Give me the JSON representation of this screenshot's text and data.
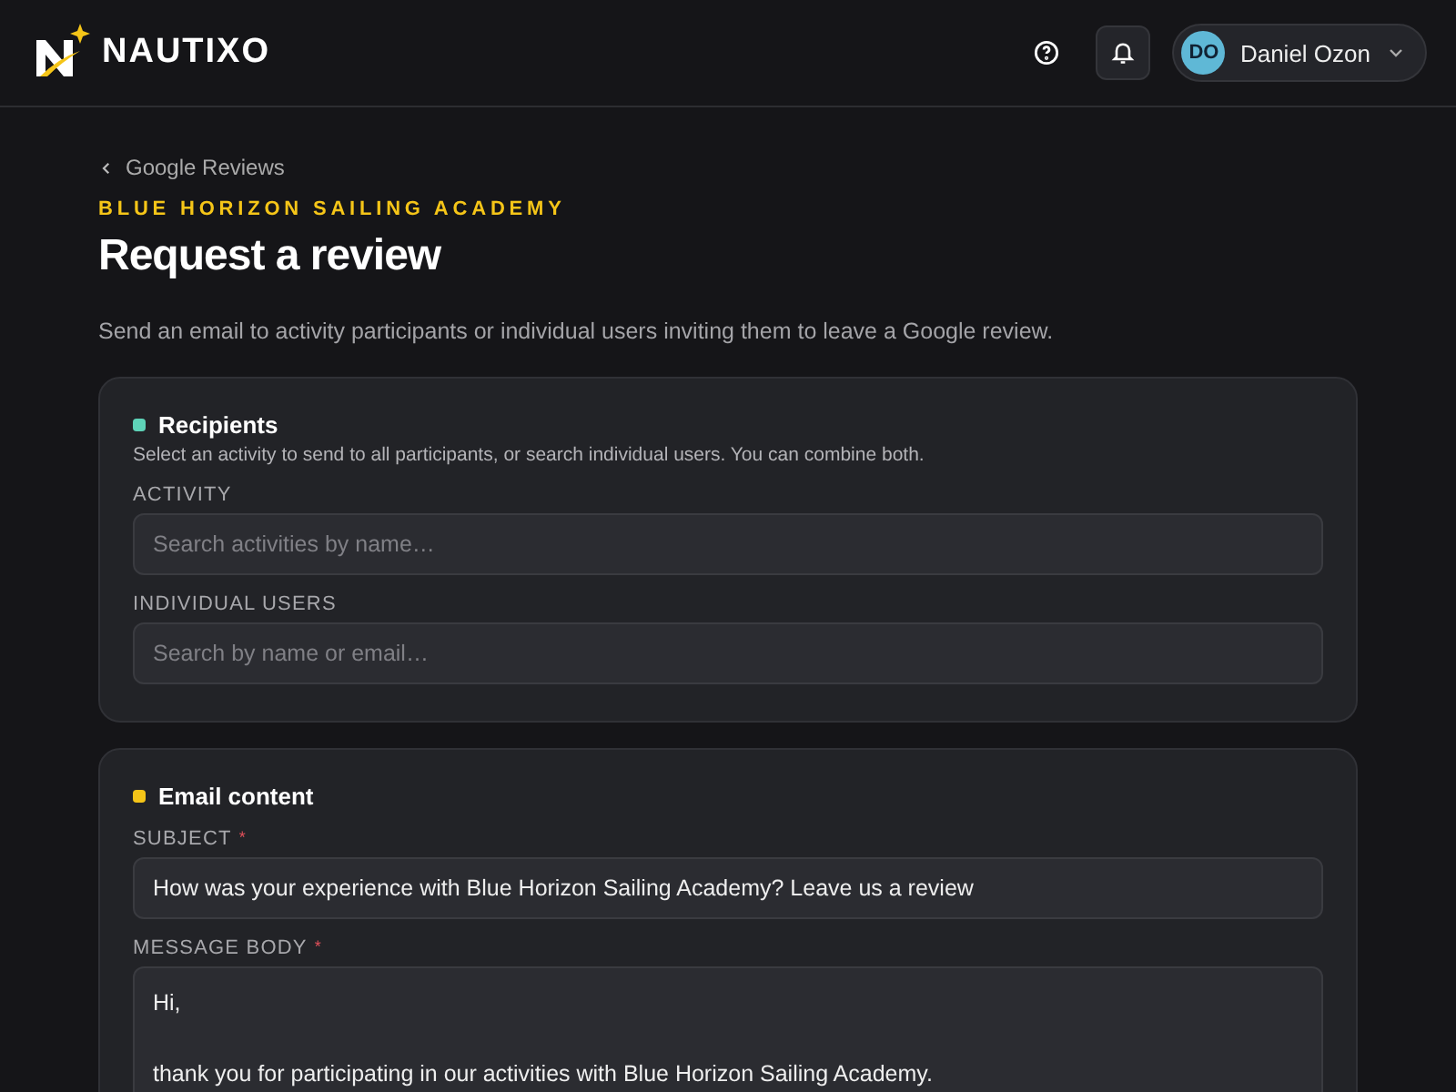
{
  "header": {
    "logo": "NAUTIXO",
    "user": {
      "initials": "DO",
      "name": "Daniel Ozon"
    }
  },
  "breadcrumb": "Google Reviews",
  "organization": "BLUE HORIZON SAILING ACADEMY",
  "title": "Request a review",
  "description": "Send an email to activity participants or individual users inviting them to leave a Google review.",
  "sections": [
    {
      "title": "Recipients",
      "color": "#5ed3b8",
      "hint": "Select an activity to send to all participants, or search individual users. You can combine both.",
      "fields": [
        {
          "kind": "input",
          "label": "ACTIVITY",
          "placeholder": "Search activities by name…"
        },
        {
          "kind": "input",
          "label": "INDIVIDUAL USERS",
          "placeholder": "Search by name or email…"
        }
      ]
    },
    {
      "title": "Email content",
      "color": "#f5c518",
      "fields": [
        {
          "kind": "input",
          "label": "SUBJECT",
          "required_mark": "*",
          "value": "How was your experience with Blue Horizon Sailing Academy? Leave us a review"
        },
        {
          "kind": "textarea",
          "label": "MESSAGE BODY",
          "required_mark": "*",
          "value": "Hi,\n\nthank you for participating in our activities with Blue Horizon Sailing Academy."
        }
      ]
    }
  ]
}
